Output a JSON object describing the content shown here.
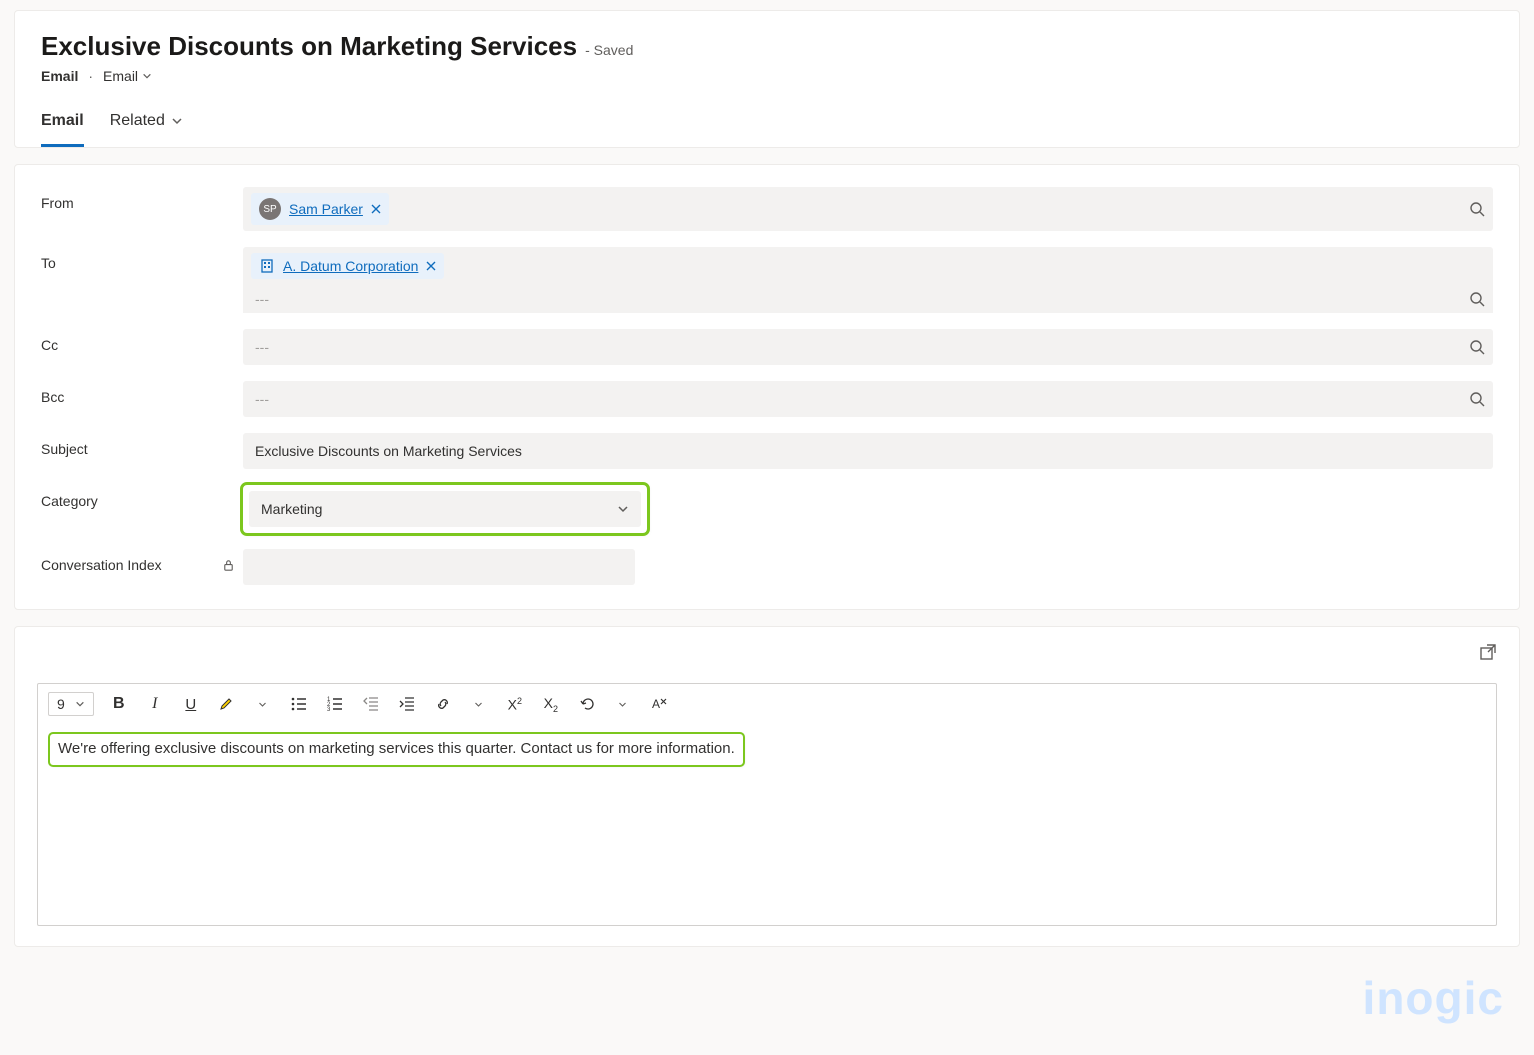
{
  "header": {
    "title": "Exclusive Discounts on Marketing Services",
    "saved_label": "- Saved",
    "breadcrumb_entity": "Email",
    "breadcrumb_form": "Email"
  },
  "tabs": [
    {
      "label": "Email",
      "active": true
    },
    {
      "label": "Related",
      "active": false
    }
  ],
  "form": {
    "from_label": "From",
    "from_chip": {
      "initials": "SP",
      "name": "Sam Parker"
    },
    "to_label": "To",
    "to_chip": {
      "name": "A. Datum Corporation"
    },
    "to_placeholder": "---",
    "cc_label": "Cc",
    "cc_placeholder": "---",
    "bcc_label": "Bcc",
    "bcc_placeholder": "---",
    "subject_label": "Subject",
    "subject_value": "Exclusive Discounts on Marketing Services",
    "category_label": "Category",
    "category_value": "Marketing",
    "conversation_index_label": "Conversation Index"
  },
  "editor": {
    "font_size": "9",
    "body_text": "We're offering exclusive discounts on marketing services this quarter. Contact us for more information."
  },
  "watermark": "inogic"
}
